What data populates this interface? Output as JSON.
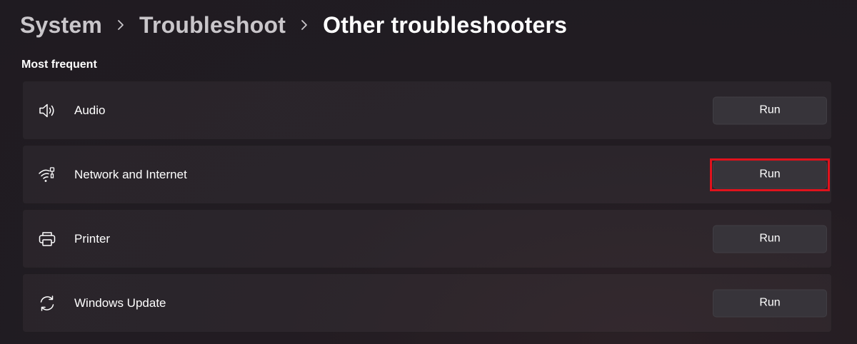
{
  "breadcrumb": {
    "items": [
      "System",
      "Troubleshoot",
      "Other troubleshooters"
    ]
  },
  "section": {
    "title": "Most frequent"
  },
  "troubleshooters": [
    {
      "label": "Audio",
      "icon": "speaker-icon",
      "button_label": "Run"
    },
    {
      "label": "Network and Internet",
      "icon": "wifi-ethernet-icon",
      "button_label": "Run",
      "highlighted": true
    },
    {
      "label": "Printer",
      "icon": "printer-icon",
      "button_label": "Run"
    },
    {
      "label": "Windows Update",
      "icon": "sync-icon",
      "button_label": "Run"
    }
  ],
  "colors": {
    "background": "#221c22",
    "card": "#2a252b",
    "button": "#37343a",
    "highlight": "#e0121c",
    "breadcrumb_inactive": "#c9c6ca"
  }
}
